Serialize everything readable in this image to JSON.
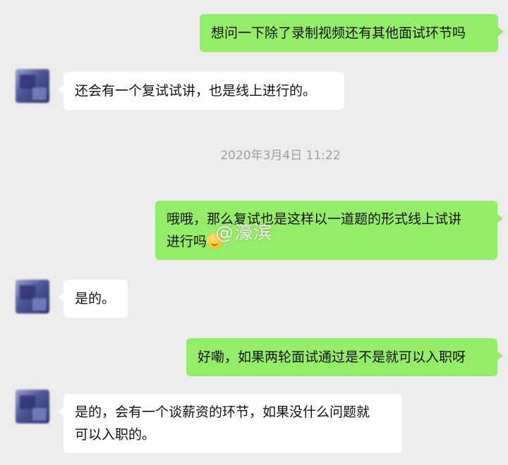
{
  "messages": [
    {
      "side": "mine",
      "lines": [
        "想问一下除了录制视频还有其他面试环节吗"
      ]
    },
    {
      "side": "theirs",
      "lines": [
        "还会有一个复试试讲，也是线上进行的。"
      ]
    },
    {
      "side": "mine",
      "lines": [
        "哦哦，那么复试也是这样以一道题的形式线上试讲",
        "进行吗"
      ]
    },
    {
      "side": "theirs",
      "lines": [
        "是的。"
      ]
    },
    {
      "side": "mine",
      "lines": [
        "好嘞，如果两轮面试通过是不是就可以入职呀"
      ]
    },
    {
      "side": "theirs",
      "lines": [
        "是的，会有一个谈薪资的环节，如果没什么问题就",
        "可以入职的。"
      ]
    }
  ],
  "timestamp": "2020年3月4日 11:22",
  "watermark": "@濠滨",
  "colors": {
    "background": "#ededed",
    "my_bubble": "#95ec69",
    "their_bubble": "#ffffff",
    "timestamp_text": "#a0a0a0"
  },
  "icons": {
    "avatar": "contact-avatar-blurred",
    "emoji": "smile-emoji-icon"
  }
}
